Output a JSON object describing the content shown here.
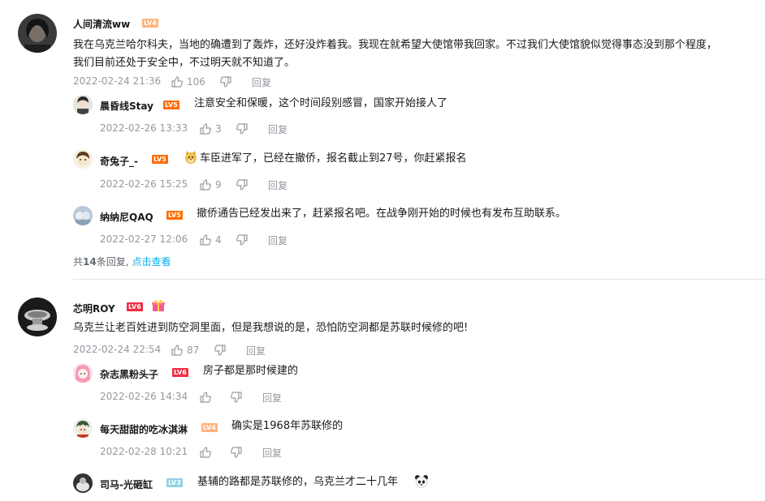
{
  "thread1": {
    "user": "人间清流ww",
    "level": "LV4",
    "level_color": "#ffb37c",
    "content_line1": "我在乌克兰哈尔科夫，当地的确遭到了轰炸，还好没炸着我。我现在就希望大使馆带我回家。不过我们大使馆貌似觉得事态没到那个程度，",
    "content_line2": "我们目前还处于安全中，不过明天就不知道了。",
    "time": "2022-02-24 21:36",
    "likes": "106",
    "reply_label": "回复",
    "replies": [
      {
        "user": "晨昏线Stay",
        "level": "LV5",
        "level_color": "#ff6c00",
        "content": "注意安全和保暖，这个时间段别感冒，国家开始接人了",
        "time": "2022-02-26 13:33",
        "likes": "3",
        "reply_label": "回复"
      },
      {
        "user": "奇兔子_-",
        "level": "LV5",
        "level_color": "#ff6c00",
        "content": "车臣进军了，已经在撤侨，报名截止到27号，你赶紧报名",
        "time": "2022-02-26 15:25",
        "likes": "9",
        "reply_label": "回复"
      },
      {
        "user": "纳纳尼QAQ",
        "level": "LV5",
        "level_color": "#ff6c00",
        "content": "撤侨通告已经发出来了，赶紧报名吧。在战争刚开始的时候也有发布互助联系。",
        "time": "2022-02-27 12:06",
        "likes": "4",
        "reply_label": "回复"
      }
    ],
    "summary_prefix": "共",
    "summary_count": "14",
    "summary_suffix": "条回复,",
    "summary_link": "点击查看"
  },
  "thread2": {
    "user": "芯明ROY",
    "level": "LV6",
    "level_color": "#ee2e44",
    "content": "乌克兰让老百姓进到防空洞里面，但是我想说的是，恐怕防空洞都是苏联时候修的吧!",
    "time": "2022-02-24 22:54",
    "likes": "87",
    "reply_label": "回复",
    "replies": [
      {
        "user": "杂志黑粉头子",
        "level": "LV6",
        "level_color": "#ee2e44",
        "content": "房子都是那时候建的",
        "time": "2022-02-26 14:34",
        "likes": "",
        "reply_label": "回复"
      },
      {
        "user": "每天甜甜的吃冰淇淋",
        "level": "LV4",
        "level_color": "#ffb37c",
        "content": "确实是1968年苏联修的",
        "time": "2022-02-28 10:21",
        "likes": "",
        "reply_label": "回复"
      },
      {
        "user": "司马-光砸缸",
        "level": "LV3",
        "level_color": "#92d1e5",
        "content": "基辅的路都是苏联修的，乌克兰才二十几年",
        "time": "",
        "likes": "",
        "reply_label": ""
      }
    ]
  },
  "icons": [
    "thumb-up-icon",
    "thumb-down-icon",
    "doge-emoji-icon",
    "panda-emoji-icon",
    "gift-badge-icon"
  ]
}
